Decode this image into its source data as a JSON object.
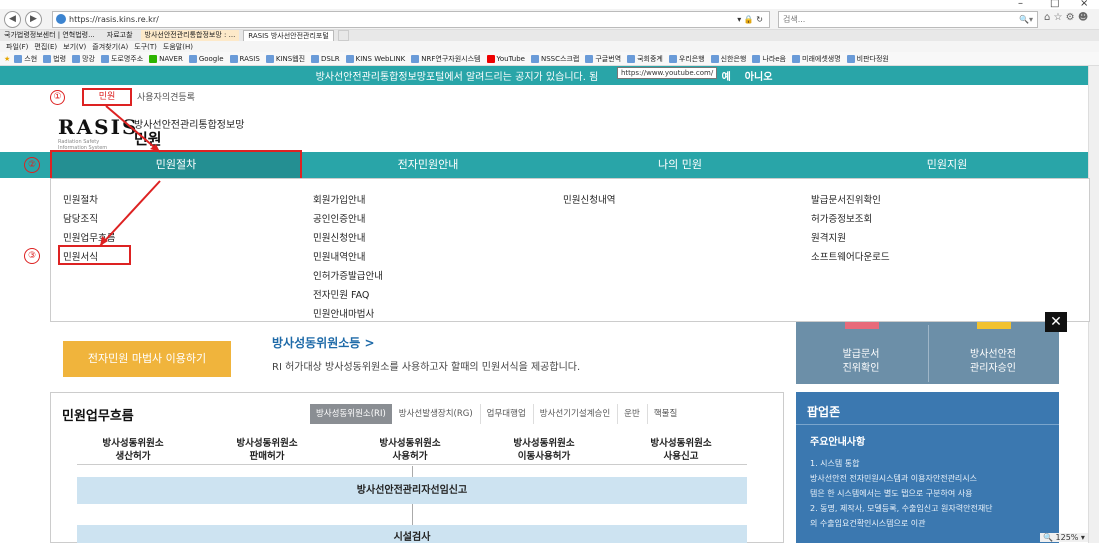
{
  "window": {
    "min": "–",
    "max": "□",
    "close": "×"
  },
  "browser": {
    "url": "https://rasis.kins.re.kr/",
    "url_suffix": "▾ 🔒 ↻",
    "search_placeholder": "검색...",
    "search_icon": "🔍▾",
    "toolbar_icons": "⌂ ☆ ⚙ ☻",
    "tabs": [
      {
        "label": "국가법령정보센터 | 연혁법령...",
        "active": false
      },
      {
        "label": "자료고찰",
        "active": false
      },
      {
        "label": "방사선안전관리통합정보망 : ...",
        "active": false
      },
      {
        "label": "RASIS 방사선안전관리포털",
        "active": true
      }
    ],
    "menu": [
      "파일(F)",
      "편집(E)",
      "보기(V)",
      "즐겨찾기(A)",
      "도구(T)",
      "도움말(H)"
    ],
    "favorites": [
      "스현",
      "법령",
      "망강",
      "도로명주소",
      "NAVER",
      "Google",
      "RASIS",
      "KINS웹진",
      "DSLR",
      "KINS WebLINK",
      "NRF연구자원시스템",
      "YouTube",
      "NSSC스크랩",
      "구글번역",
      "국회중계",
      "우리은행",
      "신한은행",
      "나라e음",
      "미래에셋생명",
      "비판다정원"
    ],
    "tooltip": "https://www.youtube.com/",
    "zoom": "125%"
  },
  "notice": {
    "text": "방사선안전관리통합정보망포털에서 알려드리는 공지가 있습니다. 됨",
    "suffix": "?",
    "yes": "예",
    "no": "아니오"
  },
  "util_nav": {
    "marker": "①",
    "minwon": "민원",
    "register": "사용자의견등록"
  },
  "logo": {
    "rasis": "RASIS",
    "sub": "Radiation Safety Information System",
    "site_name": "방사선안전관리통합정보망",
    "section": "민원"
  },
  "nav": [
    "민원절차",
    "전자민원안내",
    "나의 민원",
    "민원지원"
  ],
  "markers": {
    "m2": "②",
    "m3": "③"
  },
  "mega": {
    "col1": [
      "민원절차",
      "담당조직",
      "민원업무흐름",
      "민원서식"
    ],
    "col2": [
      "회원가입안내",
      "공인인증안내",
      "민원신청안내",
      "민원내역안내",
      "인허가증발급안내",
      "전자민원 FAQ",
      "민원안내마법사"
    ],
    "col3": [
      "민원신청내역"
    ],
    "col4": [
      "발급문서진위확인",
      "허가증정보조회",
      "원격지원",
      "소프트웨어다운로드"
    ],
    "close": "✕"
  },
  "wizard_button": "전자민원 마법사 이용하기",
  "facility": {
    "title": "방사성동위원소등 >",
    "desc": "RI 허가대상 방사성동위원소를 사용하고자 할때의 민원서식을 제공합니다."
  },
  "side_panel": {
    "item1": [
      "발급문서",
      "진위확인"
    ],
    "item2": [
      "방사선안전",
      "관리자승인"
    ]
  },
  "flow": {
    "title": "민원업무흐름",
    "tabs": [
      "방사성동위원소(RI)",
      "방사선발생장치(RG)",
      "업무대행업",
      "방사선기기설계승인",
      "운반",
      "핵물질"
    ],
    "heads": [
      [
        "방사성동위원소",
        "생산허가"
      ],
      [
        "방사성동위원소",
        "판매허가"
      ],
      [
        "방사성동위원소",
        "사용허가"
      ],
      [
        "방사성동위원소",
        "이동사용허가"
      ],
      [
        "방사성동위원소",
        "사용신고"
      ]
    ],
    "bar1": "방사선안전관리자선임신고",
    "bar2": "시설검사"
  },
  "popup": {
    "title": "팝업존",
    "subtitle": "주요안내사항",
    "lines": [
      "1. 시스템 통합",
      "방사선안전 전자민원시스템과 이용자안전관리시스",
      "템은 한 시스템에서는 별도 탭으로 구분하여 사용",
      "2. 동명, 제작사, 모델등록, 수출입신고 원자력안전재단",
      "의 수출입요건확인시스템으로 이관"
    ]
  }
}
